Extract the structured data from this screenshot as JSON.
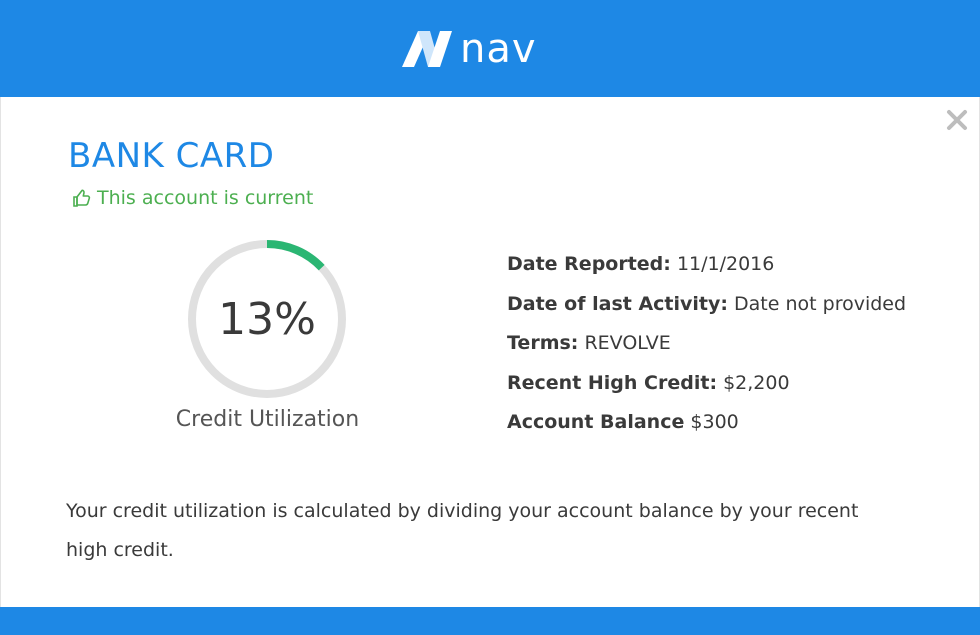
{
  "brand": {
    "name": "nav",
    "color": "#1e88e5"
  },
  "account": {
    "title": "BANK CARD",
    "status": "This account is current",
    "status_color": "#4caf50"
  },
  "utilization": {
    "percent_label": "13%",
    "percent_value": 0.13,
    "label": "Credit Utilization",
    "ring_color": "#e0e0e0",
    "fill_color": "#2bb673"
  },
  "details": [
    {
      "label": "Date Reported:",
      "value": "11/1/2016"
    },
    {
      "label": "Date of last Activity:",
      "value": "Date not provided"
    },
    {
      "label": "Terms:",
      "value": "REVOLVE"
    },
    {
      "label": "Recent High Credit:",
      "value": "$2,200"
    },
    {
      "label": "Account Balance",
      "value": "$300"
    }
  ],
  "note": "Your credit utilization is calculated by dividing your account balance by your recent high credit.",
  "icons": {
    "close": "close-icon",
    "status": "thumbs-up-icon",
    "logo": "nav-logo-icon"
  }
}
